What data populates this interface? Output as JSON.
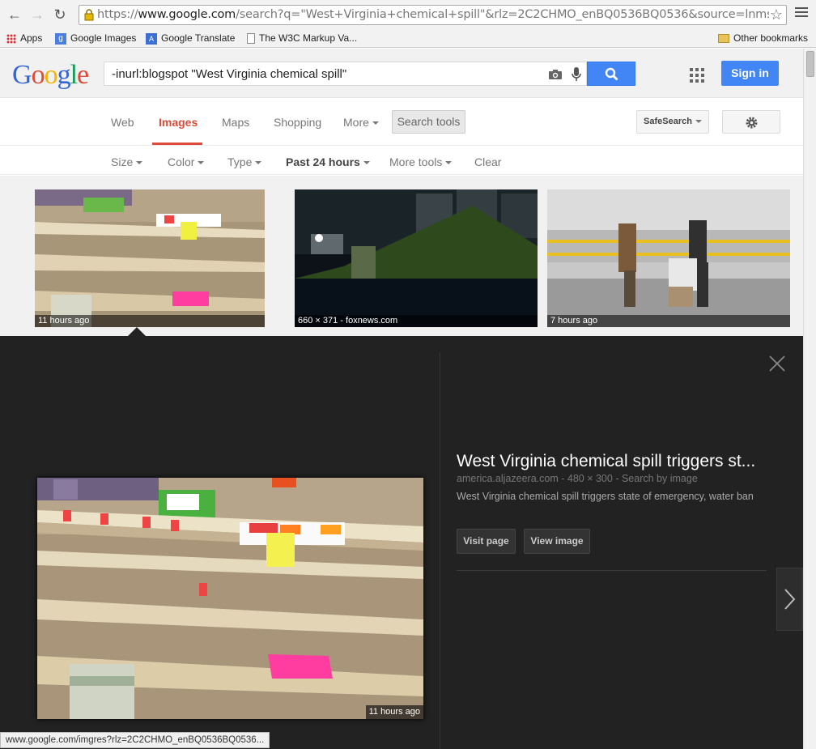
{
  "browser": {
    "url_prefix": "https://",
    "url_host": "www.google.com",
    "url_rest": "/search?q=\"West+Virginia+chemical+spill\"&rlz=2C2CHMO_enBQ0536BQ0536&source=lnms",
    "bookmarks": [
      "Apps",
      "Google Images",
      "Google Translate",
      "The W3C Markup Va..."
    ],
    "other_bookmarks": "Other bookmarks",
    "status_url": "www.google.com/imgres?rlz=2C2CHMO_enBQ0536BQ0536..."
  },
  "header": {
    "query": "-inurl:blogspot \"West Virginia chemical spill\"",
    "signin": "Sign in"
  },
  "tabs": {
    "items": [
      "Web",
      "Images",
      "Maps",
      "Shopping",
      "More"
    ],
    "search_tools": "Search tools",
    "safesearch": "SafeSearch"
  },
  "tools": {
    "size": "Size",
    "color": "Color",
    "type": "Type",
    "time": "Past 24 hours",
    "more": "More tools",
    "clear": "Clear"
  },
  "results": [
    {
      "caption": "11 hours ago"
    },
    {
      "caption": "660 × 371 - foxnews.com"
    },
    {
      "caption": "7 hours ago"
    }
  ],
  "preview": {
    "title": "West Virginia chemical spill triggers st...",
    "source": "america.aljazeera.com",
    "dims": "480 × 300",
    "search_by_image": "Search by image",
    "description": "West Virginia chemical spill triggers state of emergency, water ban",
    "visit_page": "Visit page",
    "view_image": "View image",
    "caption": "11 hours ago"
  },
  "colors": {
    "accent_blue": "#4285f4",
    "accent_red": "#dd4b39",
    "panel_bg": "#222222"
  }
}
